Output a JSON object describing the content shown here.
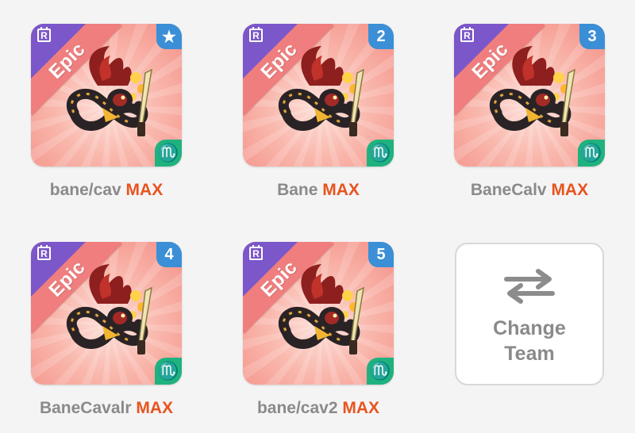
{
  "colors": {
    "background": "#f4f4f5",
    "card_pink": "#f48f86",
    "rarity_ribbon": "#f07e7e",
    "event_corner": "#7b57c9",
    "badge_blue": "#3b8fd6",
    "element_green": "#1fb27f",
    "max_orange": "#e8541e",
    "name_gray": "#8a8a8a"
  },
  "team_slots": [
    {
      "name": "bane/cav",
      "level_tag": "MAX",
      "rarity": "Epic",
      "event_icon": "R",
      "badge": "★",
      "badge_icon": "star-icon",
      "element_symbol": "♏",
      "element_icon": "scorpio-element-icon"
    },
    {
      "name": "Bane",
      "level_tag": "MAX",
      "rarity": "Epic",
      "event_icon": "R",
      "badge": "2",
      "element_symbol": "♏",
      "element_icon": "scorpio-element-icon"
    },
    {
      "name": "BaneCalv",
      "level_tag": "MAX",
      "rarity": "Epic",
      "event_icon": "R",
      "badge": "3",
      "element_symbol": "♏",
      "element_icon": "scorpio-element-icon"
    },
    {
      "name": "BaneCavalr",
      "level_tag": "MAX",
      "rarity": "Epic",
      "event_icon": "R",
      "badge": "4",
      "element_symbol": "♏",
      "element_icon": "scorpio-element-icon"
    },
    {
      "name": "bane/cav2",
      "level_tag": "MAX",
      "rarity": "Epic",
      "event_icon": "R",
      "badge": "5",
      "element_symbol": "♏",
      "element_icon": "scorpio-element-icon"
    }
  ],
  "change_team": {
    "label_line1": "Change",
    "label_line2": "Team",
    "icon": "swap-arrows-icon"
  }
}
